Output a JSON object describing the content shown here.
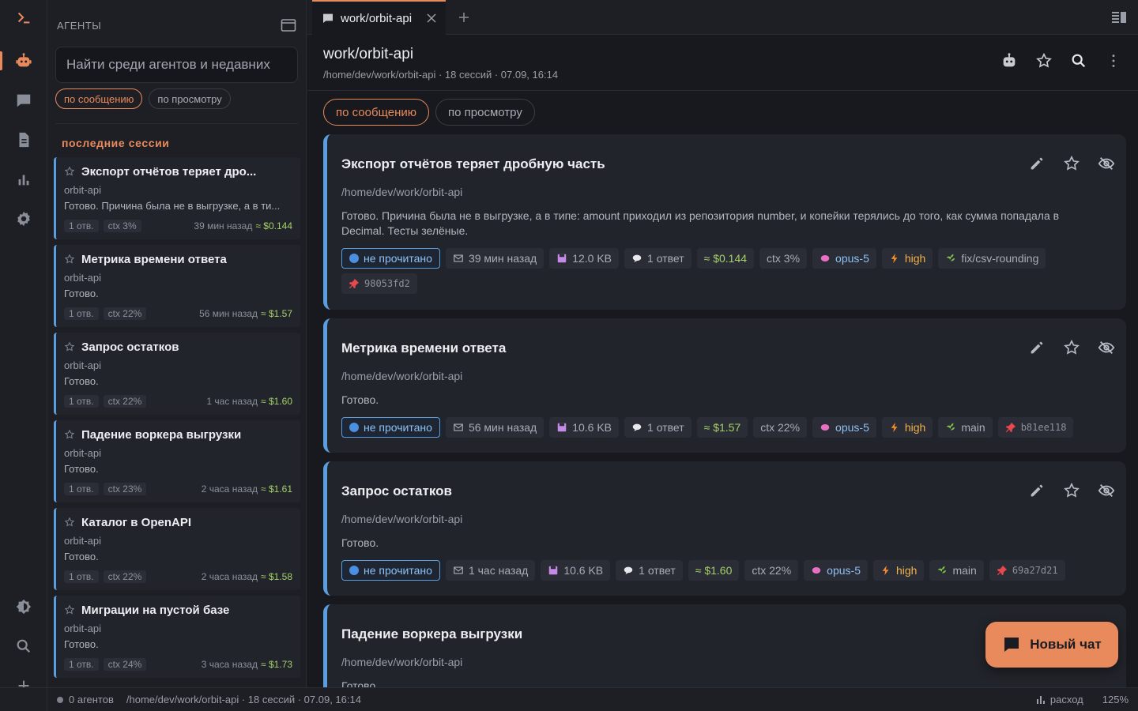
{
  "sidebar": {
    "title": "АГЕНТЫ",
    "search_placeholder": "Найти среди агентов и недавних",
    "filters": [
      "по сообщению",
      "по просмотру"
    ],
    "section_title": "последние сессии",
    "items": [
      {
        "name": "Экспорт отчётов теряет дро...",
        "repo": "orbit-api",
        "preview": "Готово. Причина была не в выгрузке, а в ти...",
        "replies": "1 отв.",
        "ctx": "ctx 3%",
        "time": "39 мин назад",
        "cost": "≈ $0.144"
      },
      {
        "name": "Метрика времени ответа",
        "repo": "orbit-api",
        "preview": "Готово.",
        "replies": "1 отв.",
        "ctx": "ctx 22%",
        "time": "56 мин назад",
        "cost": "≈ $1.57"
      },
      {
        "name": "Запрос остатков",
        "repo": "orbit-api",
        "preview": "Готово.",
        "replies": "1 отв.",
        "ctx": "ctx 22%",
        "time": "1 час назад",
        "cost": "≈ $1.60"
      },
      {
        "name": "Падение воркера выгрузки",
        "repo": "orbit-api",
        "preview": "Готово.",
        "replies": "1 отв.",
        "ctx": "ctx 23%",
        "time": "2 часа назад",
        "cost": "≈ $1.61"
      },
      {
        "name": "Каталог в OpenAPI",
        "repo": "orbit-api",
        "preview": "Готово.",
        "replies": "1 отв.",
        "ctx": "ctx 22%",
        "time": "2 часа назад",
        "cost": "≈ $1.58"
      },
      {
        "name": "Миграции на пустой базе",
        "repo": "orbit-api",
        "preview": "Готово.",
        "replies": "1 отв.",
        "ctx": "ctx 24%",
        "time": "3 часа назад",
        "cost": "≈ $1.73"
      }
    ]
  },
  "tab": {
    "label": "work/orbit-api"
  },
  "header": {
    "title": "work/orbit-api",
    "subtitle": "/home/dev/work/orbit-api · 18 сессий · 07.09, 16:14"
  },
  "main_filters": [
    "по сообщению",
    "по просмотру"
  ],
  "cards": [
    {
      "title": "Экспорт отчётов теряет дробную часть",
      "path": "/home/dev/work/orbit-api",
      "summary": "Готово. Причина была не в выгрузке, а в типе: amount приходил из репозитория number, и копейки терялись до того, как сумма попадала в Decimal. Тесты зелёные.",
      "unread": "не прочитано",
      "time": "39 мин назад",
      "size": "12.0 KB",
      "replies": "1 ответ",
      "cost": "≈ $0.144",
      "ctx": "ctx 3%",
      "model": "opus-5",
      "effort": "high",
      "branch": "fix/csv-rounding",
      "hash": "98053fd2"
    },
    {
      "title": "Метрика времени ответа",
      "path": "/home/dev/work/orbit-api",
      "summary": "Готово.",
      "unread": "не прочитано",
      "time": "56 мин назад",
      "size": "10.6 KB",
      "replies": "1 ответ",
      "cost": "≈ $1.57",
      "ctx": "ctx 22%",
      "model": "opus-5",
      "effort": "high",
      "branch": "main",
      "hash": "b81ee118"
    },
    {
      "title": "Запрос остатков",
      "path": "/home/dev/work/orbit-api",
      "summary": "Готово.",
      "unread": "не прочитано",
      "time": "1 час назад",
      "size": "10.6 KB",
      "replies": "1 ответ",
      "cost": "≈ $1.60",
      "ctx": "ctx 22%",
      "model": "opus-5",
      "effort": "high",
      "branch": "main",
      "hash": "69a27d21"
    },
    {
      "title": "Падение воркера выгрузки",
      "path": "/home/dev/work/orbit-api",
      "summary": "Готово."
    }
  ],
  "fab": {
    "label": "Новый чат"
  },
  "status": {
    "agents": "0 агентов",
    "path": "/home/dev/work/orbit-api · 18 сессий · 07.09, 16:14",
    "spend": "расход",
    "zoom": "125%"
  },
  "colors": {
    "accent": "#e98a5c",
    "card_border": "#5a9ee0",
    "cost": "#a6d06a",
    "effort": "#f0b24a"
  }
}
